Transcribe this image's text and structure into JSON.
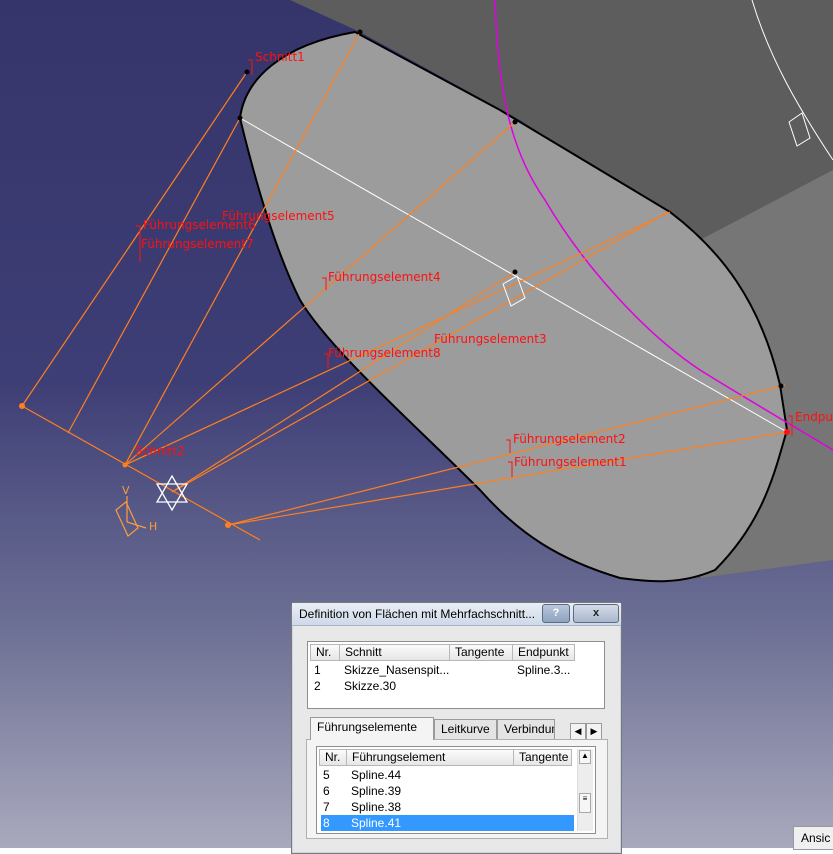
{
  "viewport": {
    "labels": {
      "schnitt1": "Schnitt1",
      "schnitt2": "Schnitt2",
      "fe1": "Führungselement1",
      "fe2": "Führungselement2",
      "fe3": "Führungselement3",
      "fe4": "Führungselement4",
      "fe5": "Führungselement5",
      "fe6": "Führungselement6",
      "fe7": "Führungselement7",
      "fe8": "Führungselement8",
      "endpunkt": "Endpu",
      "axis_v": "V",
      "axis_h": "H"
    },
    "colors": {
      "background_top": "#35356b",
      "surface": "#999999",
      "guide_lines": "#ff7f1e",
      "labels": "#ff1010",
      "spine": "#e000e0"
    }
  },
  "dialog": {
    "title": "Definition von Flächen mit Mehrfachschnitt...",
    "help_label": "?",
    "close_label": "x",
    "sections_table": {
      "columns": [
        "Nr.",
        "Schnitt",
        "Tangente",
        "Endpunkt"
      ],
      "rows": [
        {
          "nr": "1",
          "schnitt": "Skizze_Nasenspit...",
          "tangente": "",
          "endpunkt": "Spline.3..."
        },
        {
          "nr": "2",
          "schnitt": "Skizze.30",
          "tangente": "",
          "endpunkt": ""
        }
      ]
    },
    "tabs": [
      "Führungselemente",
      "Leitkurve",
      "Verbindun"
    ],
    "active_tab": "Führungselemente",
    "guides_table": {
      "columns": [
        "Nr.",
        "Führungselement",
        "Tangente"
      ],
      "rows": [
        {
          "nr": "5",
          "element": "Spline.44",
          "tangente": ""
        },
        {
          "nr": "6",
          "element": "Spline.39",
          "tangente": ""
        },
        {
          "nr": "7",
          "element": "Spline.38",
          "tangente": ""
        },
        {
          "nr": "8",
          "element": "Spline.41",
          "tangente": "",
          "selected": true
        }
      ]
    }
  },
  "status_button": "Ansic"
}
